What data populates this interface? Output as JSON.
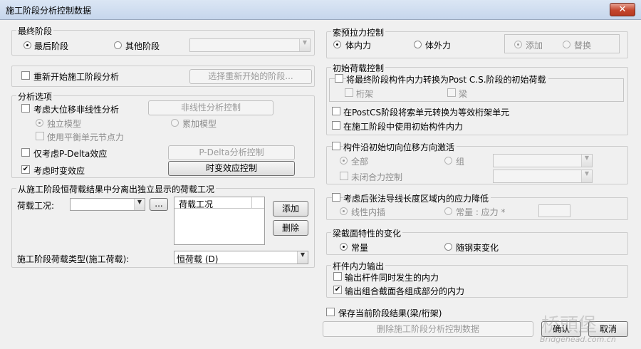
{
  "window": {
    "title": "施工阶段分析控制数据",
    "close": "✕"
  },
  "final_stage": {
    "title": "最终阶段",
    "opt_last": "最后阶段",
    "opt_other": "其他阶段"
  },
  "restart": {
    "label": "重新开始施工阶段分析",
    "button": "选择重新开始的阶段..."
  },
  "analysis": {
    "title": "分析选项",
    "large_disp": "考虑大位移非线性分析",
    "nonlinear_btn": "非线性分析控制",
    "independent": "独立模型",
    "accumulate": "累加模型",
    "balance": "使用平衡单元节点力",
    "pdelta": "仅考虑P-Delta效应",
    "pdelta_btn": "P-Delta分析控制",
    "time_dep": "考虑时变效应",
    "time_dep_btn": "时变效应控制"
  },
  "separate": {
    "title": "从施工阶段恒荷载结果中分离出独立显示的荷载工况",
    "load_case_label": "荷载工况:",
    "dots": "...",
    "list_header": "荷载工况",
    "add": "添加",
    "delete": "删除",
    "type_label": "施工阶段荷载类型(施工荷载):",
    "type_value": "恒荷载 (D)"
  },
  "cable": {
    "title": "索预拉力控制",
    "internal": "体内力",
    "external": "体外力",
    "add": "添加",
    "replace": "替换"
  },
  "initial": {
    "title": "初始荷载控制",
    "convert": "将最终阶段构件内力转换为Post C.S.阶段的初始荷载",
    "truss": "桁架",
    "beam": "梁",
    "postcs": "在PostCS阶段将索单元转换为等效桁架单元",
    "use_initial": "在施工阶段中使用初始构件内力"
  },
  "tangent": {
    "title": "构件沿初始切向位移方向激活",
    "all": "全部",
    "group": "组",
    "unclosed": "未闭合力控制"
  },
  "stress": {
    "title": "考虑后张法导线长度区域内的应力降低",
    "linear": "线性内插",
    "constant": "常量 : 应力 *"
  },
  "section": {
    "title": "梁截面特性的变化",
    "const": "常量",
    "with_tendon": "随钢束变化"
  },
  "force": {
    "title": "杆件内力输出",
    "simul": "输出杆件同时发生的内力",
    "combined": "输出组合截面各组成部分的内力"
  },
  "footer": {
    "save": "保存当前阶段结果(梁/桁架)",
    "delete_btn": "删除施工阶段分析控制数据",
    "ok": "确认",
    "cancel": "取消"
  },
  "watermark": {
    "cn": "桥頭堡",
    "en": "Bridgehead.com.cn"
  }
}
